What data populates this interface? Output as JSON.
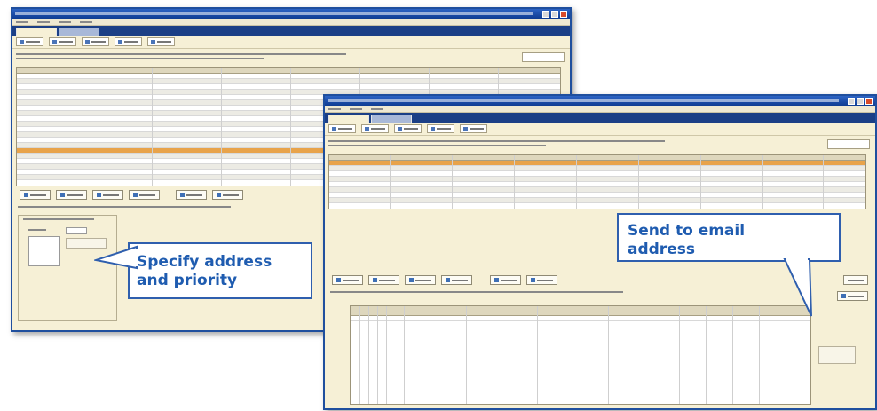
{
  "callouts": {
    "specify": "Specify address\nand priority",
    "send": "Send to email\naddress"
  },
  "colors": {
    "title_bar": "#1f4f9e",
    "window_bg": "#f6f0d6",
    "selected_row": "#e8a34a",
    "callout_border": "#2f5fae",
    "callout_text": "#1f5cb0"
  },
  "icons": [
    "close-icon",
    "maximize-icon",
    "minimize-icon",
    "toolbar-icon",
    "button-icon"
  ]
}
